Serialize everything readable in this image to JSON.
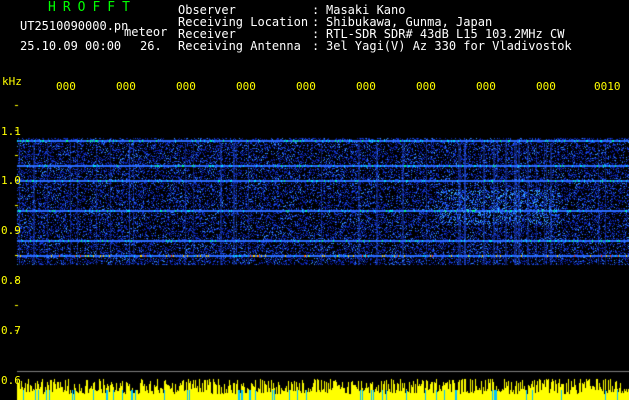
{
  "header": {
    "brand": "HROFFT",
    "file_name": "UT2510090000.pn",
    "tag": "meteor",
    "date_time": "25.10.09 00:00",
    "count": "26."
  },
  "info": [
    {
      "label": "Observer",
      "value": "Masaki Kano"
    },
    {
      "label": "Receiving Location",
      "value": "Shibukawa, Gunma, Japan"
    },
    {
      "label": "Receiver",
      "value": "RTL-SDR SDR# 43dB L15 103.2MHz CW"
    },
    {
      "label": "Receiving Antenna",
      "value": "3el Yagi(V) Az 330 for Vladivostok"
    }
  ],
  "separator": ":",
  "axes": {
    "y_unit": "kHz",
    "y_ticks": [
      "1.1",
      "1.0",
      "0.9",
      "0.8",
      "0.7",
      "0.6"
    ],
    "x_ticks": [
      "000",
      "000",
      "000",
      "000",
      "000",
      "000",
      "000",
      "000",
      "000",
      "0010"
    ]
  },
  "colors": {
    "background": "#000000",
    "header_text": "#ffffff",
    "labels": "#ffff00",
    "brand": "#00ff00",
    "signal_low": "#0000ff",
    "signal_high": "#ff0000"
  },
  "spectrogram": {
    "freq_range_khz": [
      0.6,
      1.1
    ],
    "band_khz": [
      0.78,
      1.035
    ],
    "strong_lines_khz": [
      0.8,
      0.83,
      0.89,
      0.95,
      0.98,
      1.03
    ]
  }
}
